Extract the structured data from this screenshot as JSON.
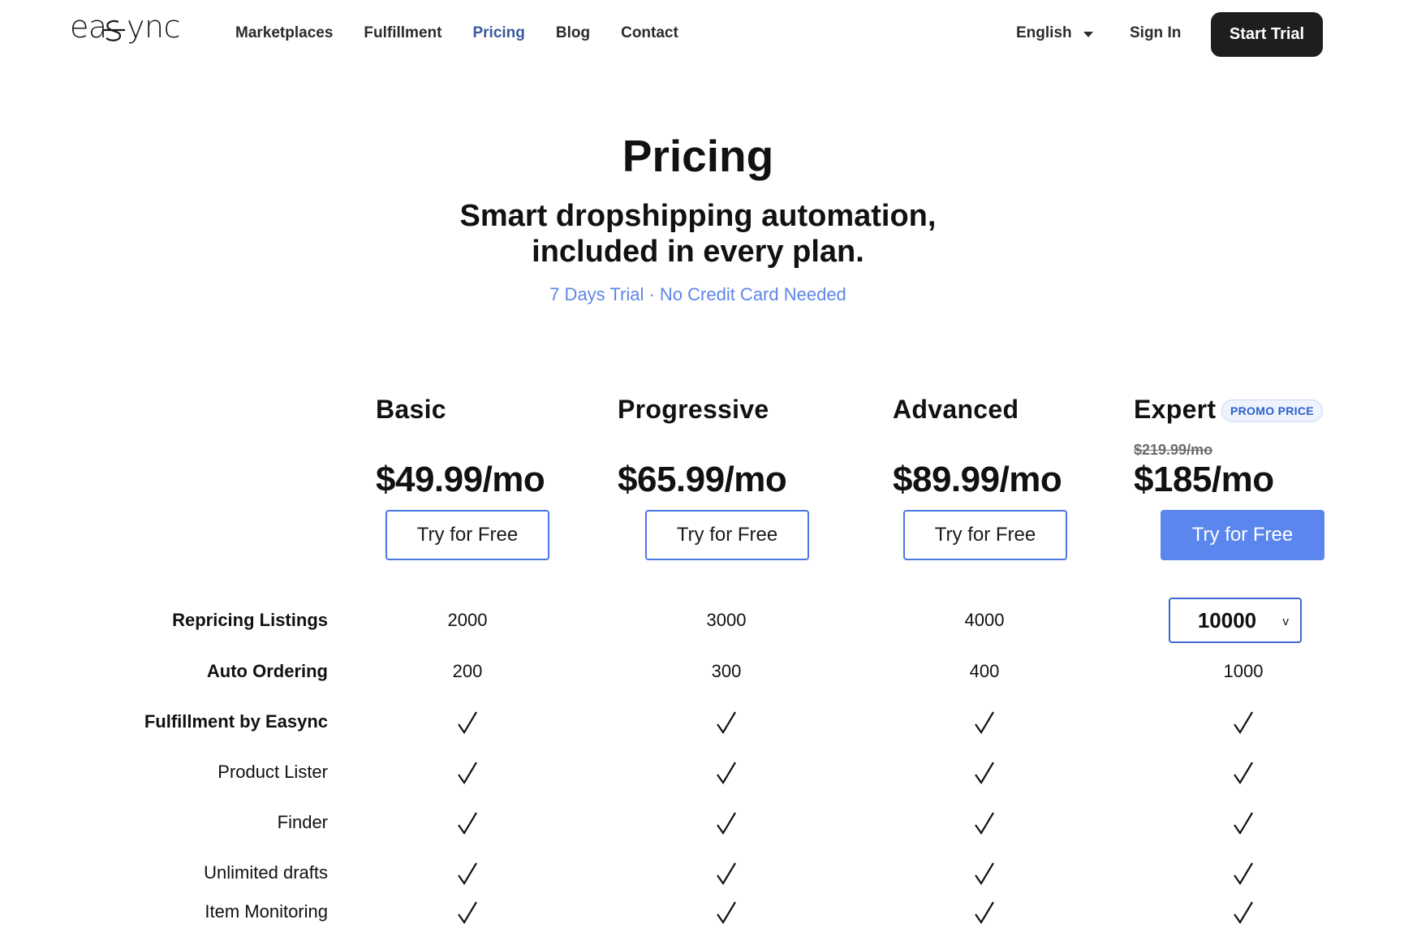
{
  "header": {
    "logo_text": "easync",
    "nav": [
      "Marketplaces",
      "Fulfillment",
      "Pricing",
      "Blog",
      "Contact"
    ],
    "active_nav": "Pricing",
    "language": "English",
    "sign_in": "Sign In",
    "start_trial": "Start Trial"
  },
  "hero": {
    "title": "Pricing",
    "subtitle_line1": "Smart dropshipping automation,",
    "subtitle_line2": "included in every plan.",
    "note": "7 Days Trial · No Credit Card Needed"
  },
  "plans": [
    {
      "name": "Basic",
      "price": "$49.99/mo",
      "cta": "Try for Free"
    },
    {
      "name": "Progressive",
      "price": "$65.99/mo",
      "cta": "Try for Free"
    },
    {
      "name": "Advanced",
      "price": "$89.99/mo",
      "cta": "Try for Free"
    },
    {
      "name": "Expert",
      "badge": "PROMO PRICE",
      "old_price": "$219.99/mo",
      "price": "$185/mo",
      "cta": "Try for Free"
    }
  ],
  "features": {
    "repricing": {
      "label": "Repricing Listings",
      "values": [
        "2000",
        "3000",
        "4000"
      ],
      "expert_select": "10000",
      "select_caret": "v"
    },
    "auto_ordering": {
      "label": "Auto Ordering",
      "values": [
        "200",
        "300",
        "400",
        "1000"
      ]
    },
    "fulfillment": {
      "label": "Fulfillment by Easync"
    },
    "product_lister": {
      "label": "Product Lister"
    },
    "finder": {
      "label": "Finder"
    },
    "unlimited_drafts": {
      "label": "Unlimited drafts"
    },
    "item_monitoring": {
      "label": "Item Monitoring"
    }
  },
  "colors": {
    "accent_blue": "#5a86ee",
    "nav_active": "#3a5a9e",
    "note_blue": "#5f86e8",
    "dark_button": "#1e1e1e"
  }
}
